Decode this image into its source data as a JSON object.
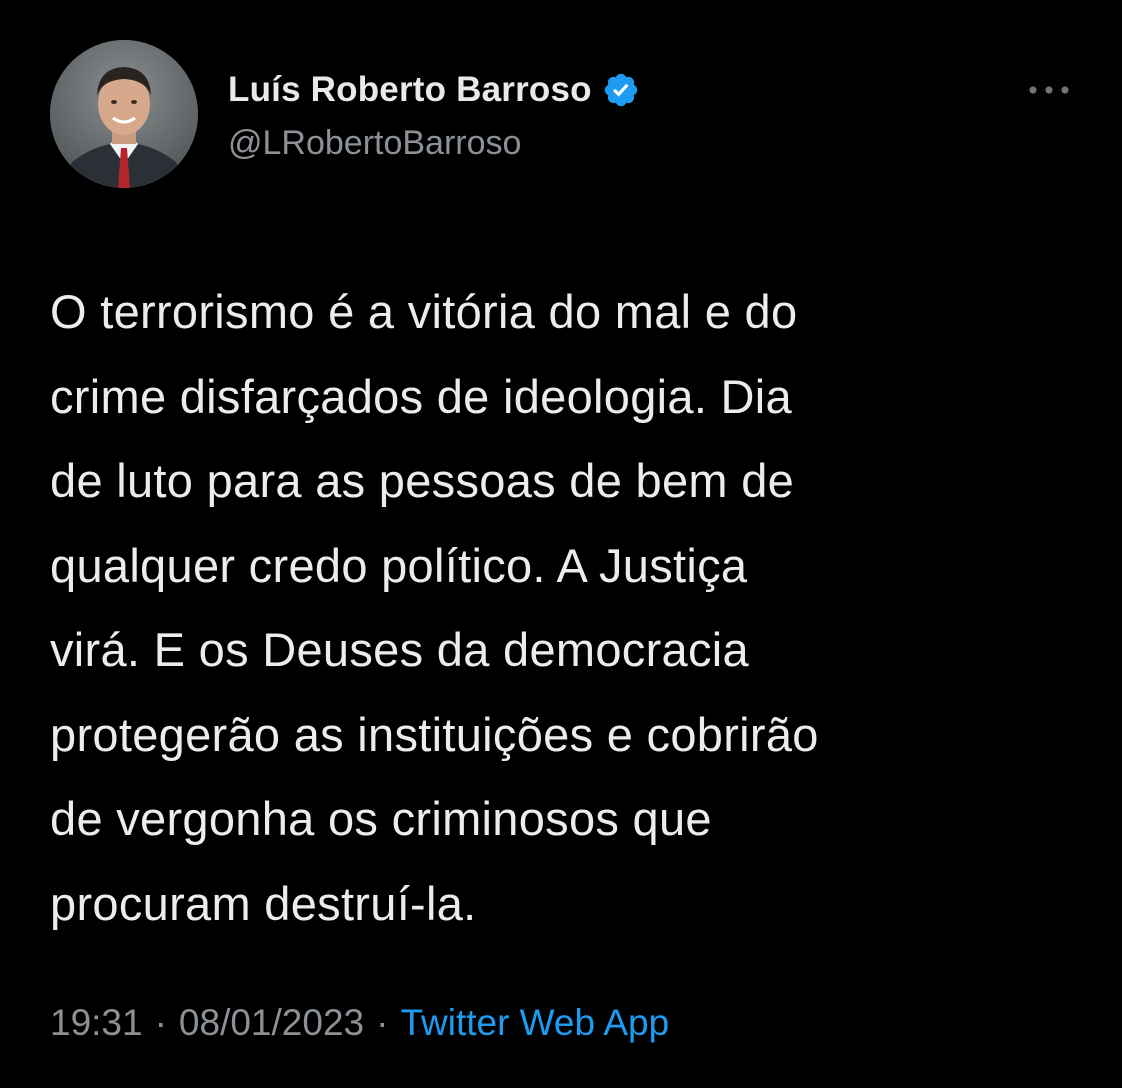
{
  "author": {
    "display_name": "Luís Roberto Barroso",
    "handle": "@LRobertoBarroso",
    "verified": true,
    "avatar_icon": "profile-photo"
  },
  "tweet": {
    "text": "O terrorismo é a vitória do mal e do\ncrime disfarçados de ideologia. Dia\nde luto para as pessoas de bem de\nqualquer credo político. A Justiça\nvirá. E os Deuses da democracia\nprotegerão as instituições e cobrirão\nde vergonha os criminosos que\nprocuram destruí-la.",
    "time": "19:31",
    "separator": "·",
    "date": "08/01/2023",
    "source": "Twitter Web App"
  },
  "icons": {
    "verified": "verified-badge-icon",
    "more": "more-options-icon"
  },
  "colors": {
    "background": "#000000",
    "text": "#e7e9ea",
    "muted": "#8b9196",
    "accent": "#1d9bf0"
  }
}
